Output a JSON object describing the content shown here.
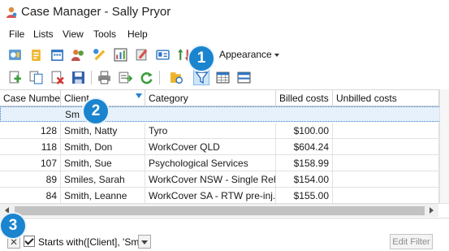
{
  "window": {
    "title": "Case Manager - Sally Pryor"
  },
  "menu": [
    "File",
    "Lists",
    "View",
    "Tools",
    "Help"
  ],
  "toolbar": {
    "appearance_label": "Appearance"
  },
  "callouts": [
    "1",
    "2",
    "3"
  ],
  "grid": {
    "columns": [
      "Case Number",
      "Client",
      "Category",
      "Billed costs",
      "Unbilled costs"
    ],
    "filter_value": "Sm",
    "rows": [
      {
        "case_number": "128",
        "client": "Smith, Natty",
        "category": "Tyro",
        "billed": "$100.00",
        "unbilled": ""
      },
      {
        "case_number": "118",
        "client": "Smith, Don",
        "category": "WorkCover QLD",
        "billed": "$604.24",
        "unbilled": ""
      },
      {
        "case_number": "107",
        "client": "Smith, Sue",
        "category": "Psychological Services",
        "billed": "$158.99",
        "unbilled": ""
      },
      {
        "case_number": "89",
        "client": "Smiles, Sarah",
        "category": "WorkCover NSW - Single Reh...",
        "billed": "$154.00",
        "unbilled": ""
      },
      {
        "case_number": "84",
        "client": "Smith, Leanne",
        "category": "WorkCover SA - RTW pre-inj...",
        "billed": "$155.00",
        "unbilled": ""
      }
    ]
  },
  "filter_panel": {
    "expression": "Starts with([Client], 'Sm')",
    "edit_filter_label": "Edit Filter"
  },
  "colors": {
    "accent": "#1a84cf",
    "filter_row_bg": "#e6f1fb"
  },
  "icons": [
    "app-icon",
    "funnel-icon",
    "close-icon",
    "dropdown-arrow-icon"
  ]
}
